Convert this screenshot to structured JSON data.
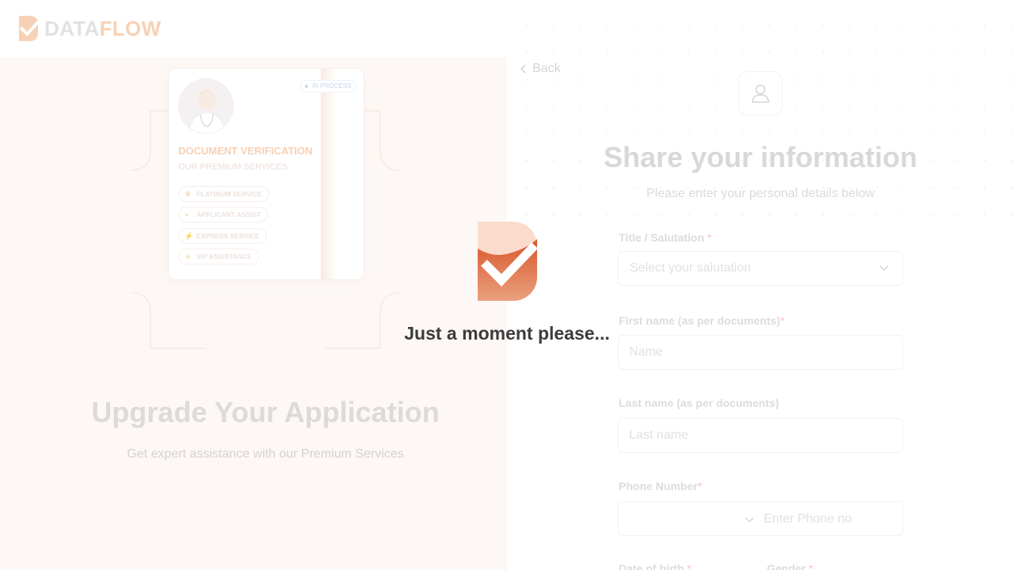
{
  "brand": {
    "name_part1": "DATA",
    "name_part2": "FLOW"
  },
  "left_panel": {
    "card": {
      "status": "IN PROCESS",
      "title": "DOCUMENT VERIFICATION",
      "subtitle": "OUR PREMIUM SERVICES",
      "services": [
        {
          "label": "PLATINUM SERVICE",
          "icon": "crown-icon"
        },
        {
          "label": "APPLICANT ASSIST",
          "icon": "person-icon"
        },
        {
          "label": "EXPRESS SERVICE",
          "icon": "lightning-icon"
        },
        {
          "label": "VIP ASSISTANCE",
          "icon": "vip-icon"
        }
      ]
    },
    "title": "Upgrade Your Application",
    "subtitle": "Get expert assistance with our Premium Services"
  },
  "form": {
    "back_label": "Back",
    "title": "Share your information",
    "subtitle": "Please enter your personal details below",
    "fields": {
      "salutation": {
        "label": "Title / Salutation",
        "required": "*",
        "placeholder": "Select your salutation"
      },
      "first_name": {
        "label": "First name (as per documents)",
        "required": "*",
        "placeholder": "Name"
      },
      "last_name": {
        "label": "Last name (as per documents)",
        "required": "",
        "placeholder": "Last name"
      },
      "phone": {
        "label": "Phone Number",
        "required": "*",
        "placeholder": "Enter Phone no"
      },
      "dob": {
        "label": "Date of birth",
        "required": "*"
      },
      "gender": {
        "label": "Gender",
        "required": "*"
      }
    }
  },
  "loading": {
    "message": "Just a moment please..."
  },
  "colors": {
    "brand_orange": "#e06a3c",
    "brand_peach": "#f7c6a8",
    "required_star": "#f4b9a6",
    "overlay_text": "#3c3c3c"
  }
}
